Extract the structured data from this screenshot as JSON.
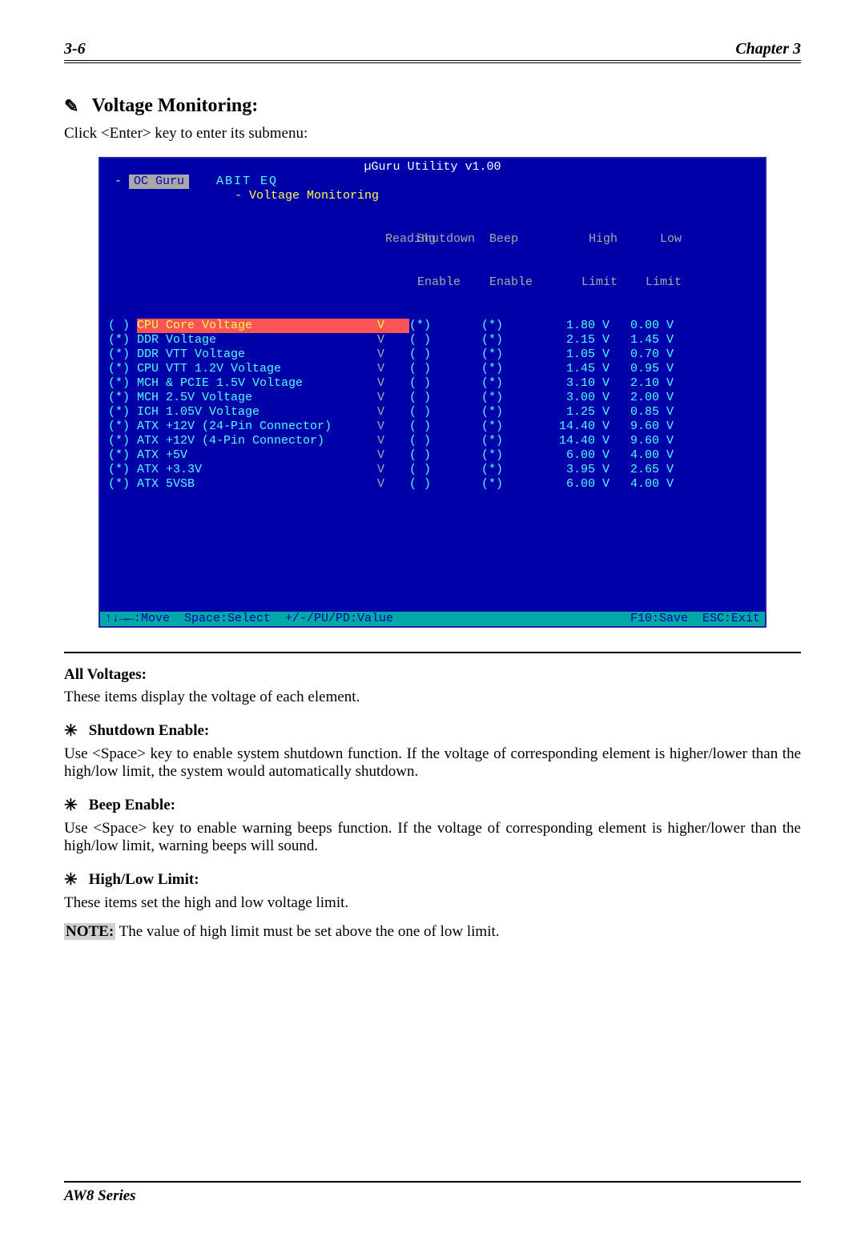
{
  "header": {
    "page": "3-6",
    "chapter": "Chapter 3"
  },
  "section": {
    "icon_name": "pointer-icon",
    "title": "Voltage Monitoring:"
  },
  "intro": "Click <Enter> key to enter its submenu:",
  "bios": {
    "title": "µGuru Utility v1.00",
    "tab_oc": "OC Guru",
    "tab_eq": "ABIT EQ",
    "submenu": "Voltage Monitoring",
    "columns": {
      "reading": "Reading",
      "shutdown1": "Shutdown",
      "shutdown2": "Enable",
      "beep1": "Beep",
      "beep2": "Enable",
      "high1": "High",
      "high2": "Limit",
      "low1": "Low",
      "low2": "Limit"
    },
    "rows": [
      {
        "mark": "( )",
        "selected": true,
        "name": "CPU Core Voltage",
        "reading": "V",
        "shut": "(*)",
        "beep": "(*)",
        "high": " 1.80 V",
        "low": " 0.00 V"
      },
      {
        "mark": "(*)",
        "selected": false,
        "name": "DDR Voltage",
        "reading": "V",
        "shut": "( )",
        "beep": "(*)",
        "high": " 2.15 V",
        "low": " 1.45 V"
      },
      {
        "mark": "(*)",
        "selected": false,
        "name": "DDR VTT Voltage",
        "reading": "V",
        "shut": "( )",
        "beep": "(*)",
        "high": " 1.05 V",
        "low": " 0.70 V"
      },
      {
        "mark": "(*)",
        "selected": false,
        "name": "CPU VTT 1.2V Voltage",
        "reading": "V",
        "shut": "( )",
        "beep": "(*)",
        "high": " 1.45 V",
        "low": " 0.95 V"
      },
      {
        "mark": "(*)",
        "selected": false,
        "name": "MCH & PCIE 1.5V Voltage",
        "reading": "V",
        "shut": "( )",
        "beep": "(*)",
        "high": " 3.10 V",
        "low": " 2.10 V"
      },
      {
        "mark": "(*)",
        "selected": false,
        "name": "MCH 2.5V Voltage",
        "reading": "V",
        "shut": "( )",
        "beep": "(*)",
        "high": " 3.00 V",
        "low": " 2.00 V"
      },
      {
        "mark": "(*)",
        "selected": false,
        "name": "ICH 1.05V Voltage",
        "reading": "V",
        "shut": "( )",
        "beep": "(*)",
        "high": " 1.25 V",
        "low": " 0.85 V"
      },
      {
        "mark": "(*)",
        "selected": false,
        "name": "ATX +12V (24-Pin Connector)",
        "reading": "V",
        "shut": "( )",
        "beep": "(*)",
        "high": "14.40 V",
        "low": " 9.60 V"
      },
      {
        "mark": "(*)",
        "selected": false,
        "name": "ATX +12V (4-Pin Connector)",
        "reading": "V",
        "shut": "( )",
        "beep": "(*)",
        "high": "14.40 V",
        "low": " 9.60 V"
      },
      {
        "mark": "(*)",
        "selected": false,
        "name": "ATX +5V",
        "reading": "V",
        "shut": "( )",
        "beep": "(*)",
        "high": " 6.00 V",
        "low": " 4.00 V"
      },
      {
        "mark": "(*)",
        "selected": false,
        "name": "ATX +3.3V",
        "reading": "V",
        "shut": "( )",
        "beep": "(*)",
        "high": " 3.95 V",
        "low": " 2.65 V"
      },
      {
        "mark": "(*)",
        "selected": false,
        "name": "ATX 5VSB",
        "reading": "V",
        "shut": "( )",
        "beep": "(*)",
        "high": " 6.00 V",
        "low": " 4.00 V"
      }
    ],
    "footer_left": "↑↓→←:Move  Space:Select  +/-/PU/PD:Value",
    "footer_right": "F10:Save  ESC:Exit"
  },
  "body": {
    "all_voltages_h": "All Voltages:",
    "all_voltages_p": "These items display the voltage of each element.",
    "shutdown_h": "Shutdown Enable:",
    "shutdown_p": "Use <Space> key to enable system shutdown function. If the voltage of corresponding element is higher/lower than the high/low limit, the system would automatically shutdown.",
    "beep_h": "Beep Enable:",
    "beep_p": "Use <Space> key to enable warning beeps function. If the voltage of corresponding element is higher/lower than the high/low limit, warning beeps will sound.",
    "limit_h": "High/Low Limit:",
    "limit_p": "These items set the high and low voltage limit.",
    "note_label": "NOTE:",
    "note_text": " The value of high limit must be set above the one of low limit."
  },
  "footer": {
    "series": "AW8 Series"
  }
}
